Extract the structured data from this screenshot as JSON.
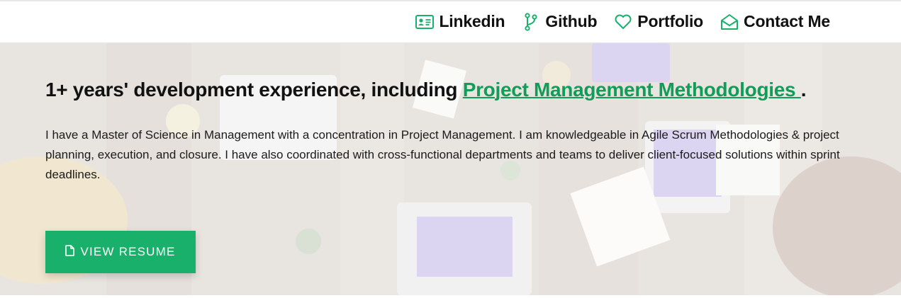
{
  "colors": {
    "accent": "#19b06b",
    "link": "#0f9d58"
  },
  "nav": {
    "items": [
      {
        "label": "Linkedin",
        "icon": "id-card-icon"
      },
      {
        "label": "Github",
        "icon": "branch-icon"
      },
      {
        "label": "Portfolio",
        "icon": "heart-icon"
      },
      {
        "label": "Contact Me",
        "icon": "envelope-open-icon"
      }
    ]
  },
  "hero": {
    "headline_prefix": "1+ years' development experience, including ",
    "headline_link": "Project Management Methodologies ",
    "headline_suffix": ".",
    "description": "I have a Master of Science in Management with a concentration in Project Management. I am knowledgeable in Agile Scrum Methodologies & project planning, execution, and closure. I have also coordinated with cross-functional departments and teams to deliver client-focused solutions within sprint deadlines.",
    "button_label": "VIEW RESUME",
    "button_icon": "file-icon"
  }
}
